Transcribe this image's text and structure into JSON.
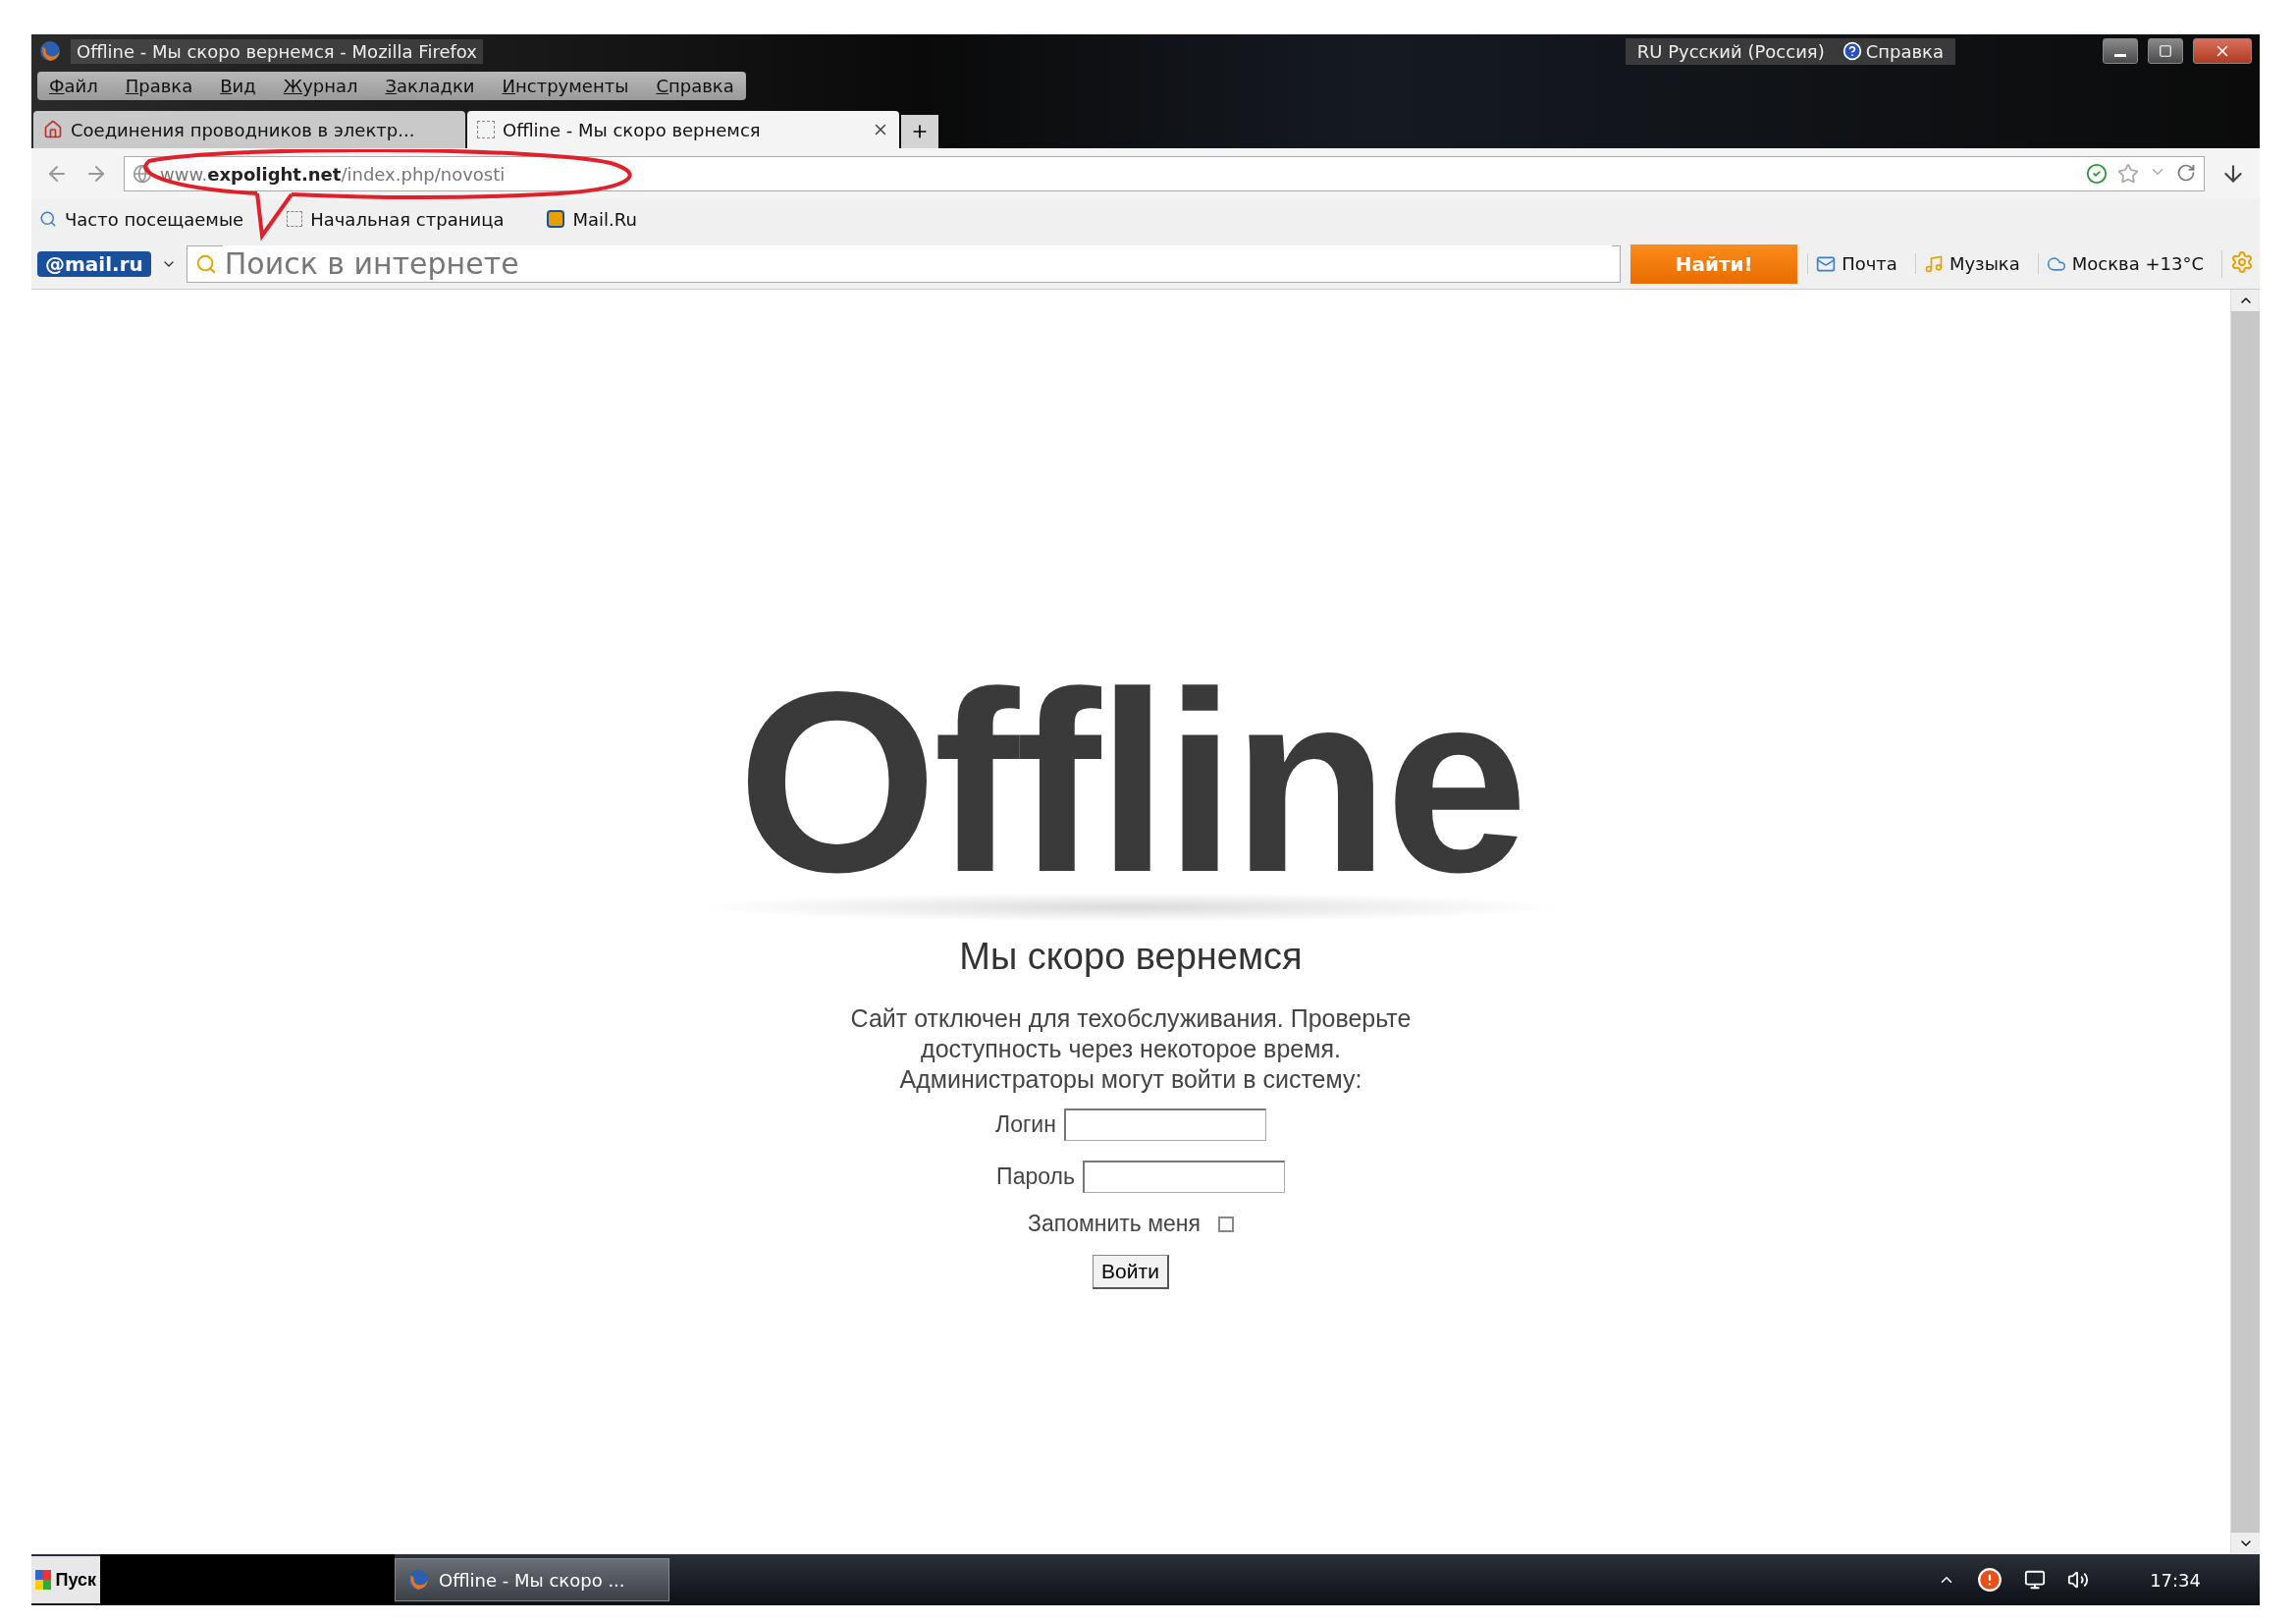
{
  "window": {
    "title": "Offline - Мы скоро вернемся - Mozilla Firefox"
  },
  "language_bar": {
    "language": "RU Русский (Россия)",
    "help": "Справка"
  },
  "menu": [
    "Файл",
    "Правка",
    "Вид",
    "Журнал",
    "Закладки",
    "Инструменты",
    "Справка"
  ],
  "tabs": [
    {
      "label": "Соединения проводников в электр...",
      "selected": false
    },
    {
      "label": "Offline - Мы скоро вернемся",
      "selected": true
    }
  ],
  "address_bar": {
    "url": "www.**expolight.net**/index.php/novosti"
  },
  "bookmarks": [
    "Часто посещаемые",
    "Начальная страница",
    "Mail.Ru"
  ],
  "mail_toolbar": {
    "logo": "@mail.ru",
    "search_placeholder": "Поиск в интернете",
    "search_button": "Найти!",
    "links": [
      "Почта",
      "Музыка",
      "Москва +13°C"
    ]
  },
  "page": {
    "heading": "Offline",
    "subheading": "Мы скоро вернемся",
    "message": [
      "Сайт отключен для техобслуживания. Проверьте",
      "доступность через некоторое время.",
      "Администраторы могут войти в систему:"
    ],
    "login_label": "Логин",
    "password_label": "Пароль",
    "remember_label": "Запомнить меня",
    "remember_checked": false,
    "submit": "Войти"
  },
  "taskbar": {
    "start": "Пуск",
    "task": "Offline - Мы скоро ...",
    "clock": "17:34"
  }
}
